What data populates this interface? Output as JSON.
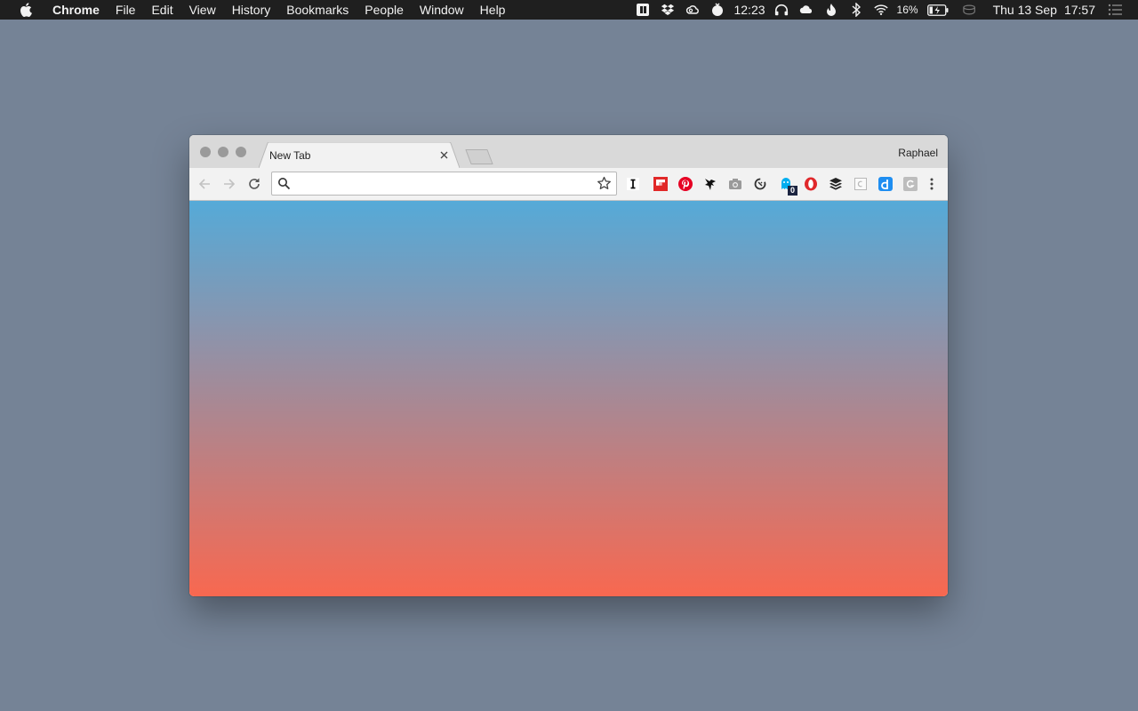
{
  "menubar": {
    "app_name": "Chrome",
    "items": [
      "File",
      "Edit",
      "View",
      "History",
      "Bookmarks",
      "People",
      "Window",
      "Help"
    ],
    "status": {
      "timer": "12:23",
      "battery": "16%",
      "date": "Thu 13 Sep",
      "time": "17:57"
    },
    "status_icons": [
      "clipboard-icon",
      "dropbox-icon",
      "creative-cloud-icon",
      "tomato-timer-icon",
      "headphones-icon",
      "cloud-icon",
      "flame-icon",
      "bluetooth-icon",
      "wifi-icon",
      "battery-icon",
      "coffee-cup-icon",
      "notification-center-icon"
    ]
  },
  "browser": {
    "tab": {
      "title": "New Tab"
    },
    "profile_name": "Raphael",
    "omnibox": {
      "value": "",
      "placeholder": ""
    },
    "extensions": [
      {
        "name": "instapaper-extension-icon",
        "color": "#111111"
      },
      {
        "name": "flipboard-extension-icon",
        "color": "#e12828"
      },
      {
        "name": "pinterest-extension-icon",
        "color": "#e60023"
      },
      {
        "name": "feedly-bird-extension-icon",
        "color": "#111111"
      },
      {
        "name": "camera-extension-icon",
        "color": "#9a9a9a"
      },
      {
        "name": "sync-extension-icon",
        "color": "#333333"
      },
      {
        "name": "ghostery-extension-icon",
        "color": "#00aef0",
        "badge": "0"
      },
      {
        "name": "opera-extension-icon",
        "color": "#e0282b"
      },
      {
        "name": "buffer-extension-icon",
        "color": "#222222"
      },
      {
        "name": "page-extension-icon",
        "color": "#b8b8b8"
      },
      {
        "name": "dashlane-extension-icon",
        "color": "#1f8ef1"
      },
      {
        "name": "grammar-extension-icon",
        "color": "#bdbdbd"
      }
    ]
  },
  "content": {
    "gradient_top": "#55aad8",
    "gradient_mid": "#9a8ea0",
    "gradient_bottom": "#f86850"
  }
}
